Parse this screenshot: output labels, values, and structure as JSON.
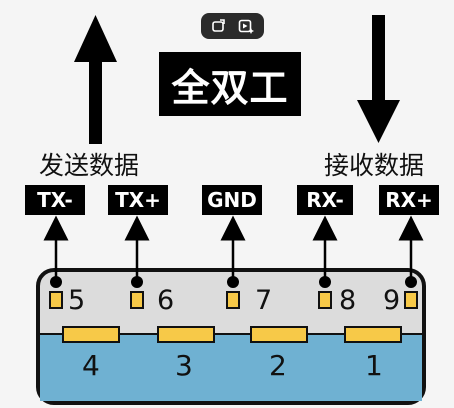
{
  "title": "全双工",
  "send_label": "发送数据",
  "receive_label": "接收数据",
  "pins_top": [
    {
      "tag": "TX-",
      "number": "5"
    },
    {
      "tag": "TX+",
      "number": "6"
    },
    {
      "tag": "GND",
      "number": "7"
    },
    {
      "tag": "RX-",
      "number": "8"
    },
    {
      "tag": "RX+",
      "number": "9"
    }
  ],
  "pins_bottom": [
    "4",
    "3",
    "2",
    "1"
  ],
  "toolbar": {
    "icons": [
      "rotate-image-icon",
      "play-sparkle-icon"
    ]
  },
  "colors": {
    "connector_blue": "#6fb1d2",
    "connector_gray": "#dcdcdc",
    "pin_yellow": "#f7c948",
    "badge_black": "#000000"
  }
}
